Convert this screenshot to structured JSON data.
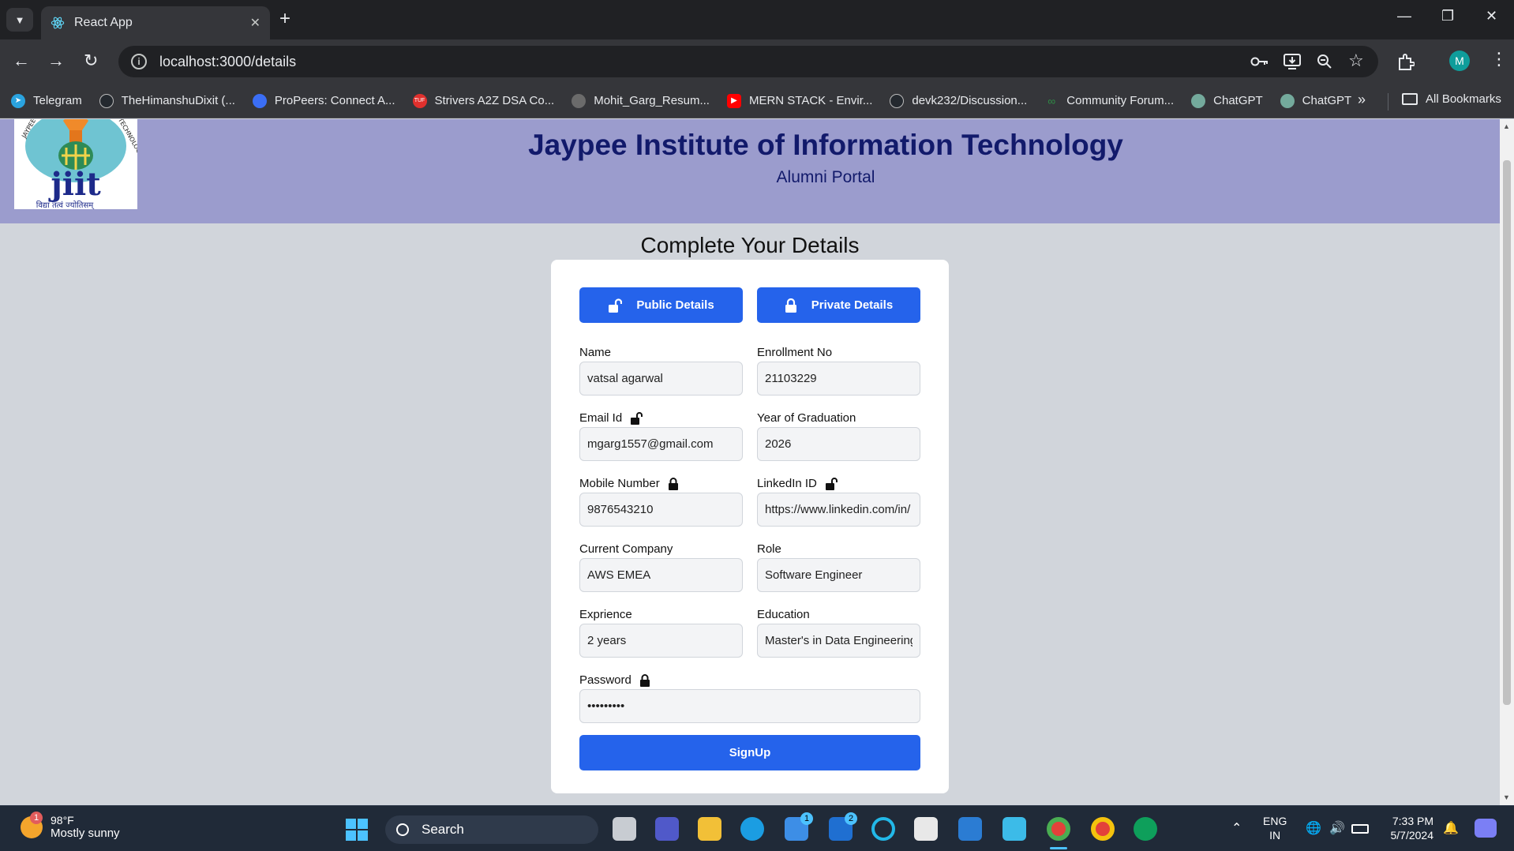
{
  "browser": {
    "tab_title": "React App",
    "url": "localhost:3000/details",
    "profile_initial": "M",
    "bookmarks": [
      {
        "label": "Telegram",
        "color": "#2aa3df"
      },
      {
        "label": "TheHimanshuDixit (...",
        "color": "#24292f"
      },
      {
        "label": "ProPeers: Connect A...",
        "color": "#3b6ef5"
      },
      {
        "label": "Strivers A2Z DSA Co...",
        "color": "#e0302d"
      },
      {
        "label": "Mohit_Garg_Resum...",
        "color": "#6b6b6b"
      },
      {
        "label": "MERN STACK - Envir...",
        "color": "#ff0000"
      },
      {
        "label": "devk232/Discussion...",
        "color": "#24292f"
      },
      {
        "label": "Community Forum...",
        "color": "#2f8d46"
      },
      {
        "label": "ChatGPT",
        "color": "#74aa9c"
      },
      {
        "label": "ChatGPT",
        "color": "#74aa9c"
      }
    ],
    "all_bookmarks_label": "All Bookmarks"
  },
  "header": {
    "title": "Jaypee Institute of Information Technology",
    "subtitle": "Alumni Portal",
    "logo_text": "jiit",
    "logo_caption": "विद्या तत्वं ज्योतिसम्"
  },
  "form": {
    "heading": "Complete Your Details",
    "public_tab": "Public Details",
    "private_tab": "Private Details",
    "fields": {
      "name": {
        "label": "Name",
        "value": "vatsal agarwal"
      },
      "enrollment": {
        "label": "Enrollment No",
        "value": "21103229"
      },
      "email": {
        "label": "Email Id",
        "value": "mgarg1557@gmail.com"
      },
      "graduation": {
        "label": "Year of Graduation",
        "value": "2026"
      },
      "mobile": {
        "label": "Mobile Number",
        "value": "9876543210"
      },
      "linkedin": {
        "label": "LinkedIn ID",
        "value": "https://www.linkedin.com/in/"
      },
      "company": {
        "label": "Current Company",
        "value": "AWS EMEA"
      },
      "role": {
        "label": "Role",
        "value": "Software Engineer"
      },
      "experience": {
        "label": "Exprience",
        "value": "2 years"
      },
      "education": {
        "label": "Education",
        "value": "Master's in Data Engineering"
      },
      "password": {
        "label": "Password",
        "value": "password1"
      }
    },
    "submit_label": "SignUp"
  },
  "taskbar": {
    "temperature": "98°F",
    "weather": "Mostly sunny",
    "weather_badge": "1",
    "search_label": "Search",
    "store_badge": "1",
    "l_badge": "2",
    "lang_line1": "ENG",
    "lang_line2": "IN",
    "time": "7:33 PM",
    "date": "5/7/2024"
  }
}
